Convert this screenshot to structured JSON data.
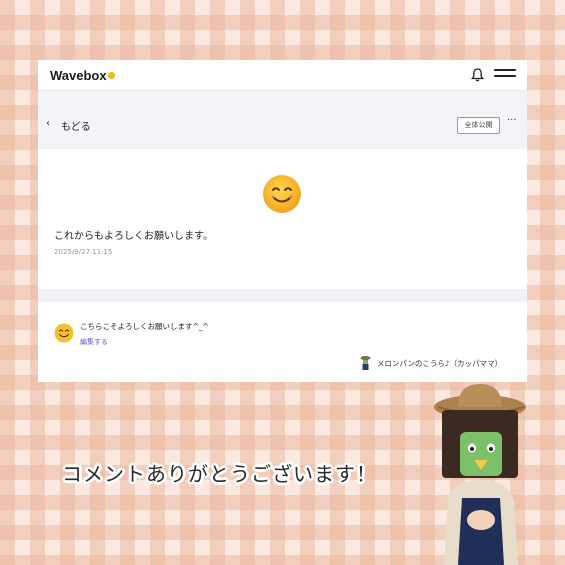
{
  "app": {
    "logo_text": "Wavebox",
    "brand_dot_color": "#f3b81a"
  },
  "nav": {
    "back_label": "もどる",
    "visibility_badge": "全体公開",
    "more_label": "···"
  },
  "post": {
    "emoji": "smiling-face",
    "message": "これからもよろしくお願いします。",
    "timestamp": "2025/9/27 11:15"
  },
  "comment": {
    "text": "こちらこそよろしくお願いします^_^",
    "edit_label": "編集する",
    "author": "メロンパンのこうら♪（カッパママ）"
  },
  "caption": "コメントありがとうございます！",
  "colors": {
    "accent_link": "#6a4fd8",
    "check_light": "#fbe9e1",
    "check_dark": "#eab9a0"
  }
}
